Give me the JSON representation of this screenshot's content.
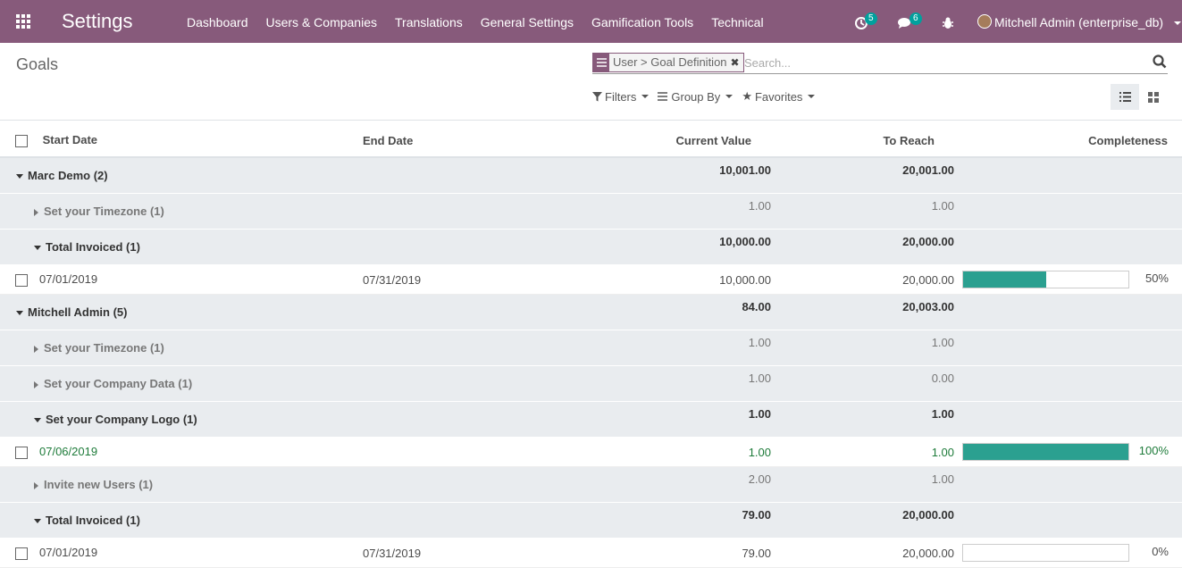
{
  "app": {
    "title": "Settings"
  },
  "menu": [
    "Dashboard",
    "Users & Companies",
    "Translations",
    "General Settings",
    "Gamification Tools",
    "Technical"
  ],
  "systray": {
    "activity_count": "5",
    "messages_count": "6",
    "user_name": "Mitchell Admin (enterprise_db)"
  },
  "breadcrumb": "Goals",
  "search": {
    "facet_value": "User > Goal Definition",
    "placeholder": "Search..."
  },
  "filters": {
    "filters": "Filters",
    "group_by": "Group By",
    "favorites": "Favorites"
  },
  "columns": {
    "start_date": "Start Date",
    "end_date": "End Date",
    "current_value": "Current Value",
    "to_reach": "To Reach",
    "completeness": "Completeness"
  },
  "rows": [
    {
      "type": "group1",
      "label": "Marc Demo (2)",
      "current": "10,001.00",
      "reach": "20,001.00"
    },
    {
      "type": "group2",
      "label": "Set your Timezone (1)",
      "current": "1.00",
      "reach": "1.00"
    },
    {
      "type": "group2open",
      "label": "Total Invoiced (1)",
      "current": "10,000.00",
      "reach": "20,000.00"
    },
    {
      "type": "record",
      "start": "07/01/2019",
      "end": "07/31/2019",
      "current": "10,000.00",
      "reach": "20,000.00",
      "completeness": "50%",
      "progress": 0.5
    },
    {
      "type": "group1",
      "label": "Mitchell Admin (5)",
      "current": "84.00",
      "reach": "20,003.00"
    },
    {
      "type": "group2",
      "label": "Set your Timezone (1)",
      "current": "1.00",
      "reach": "1.00"
    },
    {
      "type": "group2",
      "label": "Set your Company Data (1)",
      "current": "1.00",
      "reach": "0.00"
    },
    {
      "type": "group2open",
      "label": "Set your Company Logo (1)",
      "current": "1.00",
      "reach": "1.00"
    },
    {
      "type": "record",
      "green": true,
      "start": "07/06/2019",
      "end": "",
      "current": "1.00",
      "reach": "1.00",
      "completeness": "100%",
      "progress": 1.0
    },
    {
      "type": "group2",
      "label": "Invite new Users (1)",
      "current": "2.00",
      "reach": "1.00"
    },
    {
      "type": "group2open",
      "label": "Total Invoiced (1)",
      "current": "79.00",
      "reach": "20,000.00"
    },
    {
      "type": "record",
      "start": "07/01/2019",
      "end": "07/31/2019",
      "current": "79.00",
      "reach": "20,000.00",
      "completeness": "0%",
      "progress": 0.0
    }
  ],
  "colors": {
    "brand": "#875a7b",
    "progress": "#2ba090",
    "badge": "#00a09d",
    "done_text": "#1e7b3a"
  }
}
